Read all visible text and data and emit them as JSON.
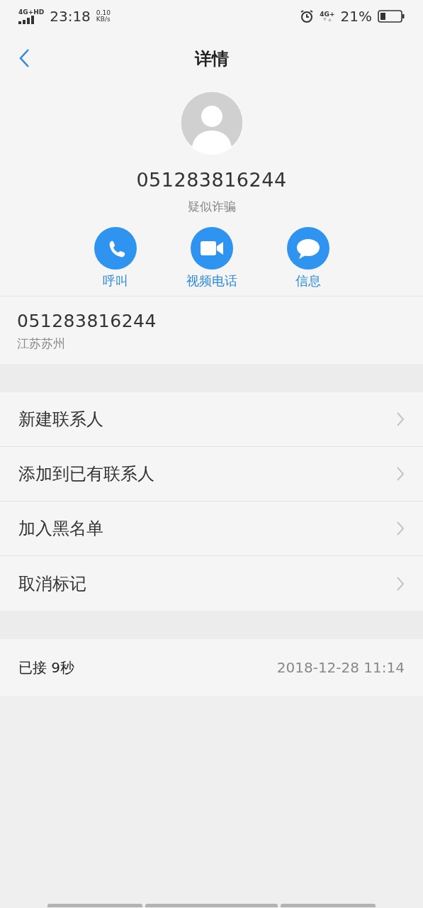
{
  "status_bar": {
    "network": "4G+HD",
    "time": "23:18",
    "speed_value": "0.10",
    "speed_unit": "KB/s",
    "network_right": "4G+",
    "battery": "21%"
  },
  "header": {
    "title": "详情"
  },
  "contact": {
    "number": "051283816244",
    "tag": "疑似诈骗"
  },
  "actions": [
    {
      "kind": "call",
      "label": "呼叫"
    },
    {
      "kind": "video",
      "label": "视频电话"
    },
    {
      "kind": "message",
      "label": "信息"
    }
  ],
  "number_row": {
    "number": "051283816244",
    "location": "江苏苏州"
  },
  "menu": [
    {
      "label": "新建联系人"
    },
    {
      "label": "添加到已有联系人"
    },
    {
      "label": "加入黑名单"
    },
    {
      "label": "取消标记"
    }
  ],
  "call_log": [
    {
      "status": "已接 9秒",
      "time": "2018-12-28 11:14"
    }
  ]
}
